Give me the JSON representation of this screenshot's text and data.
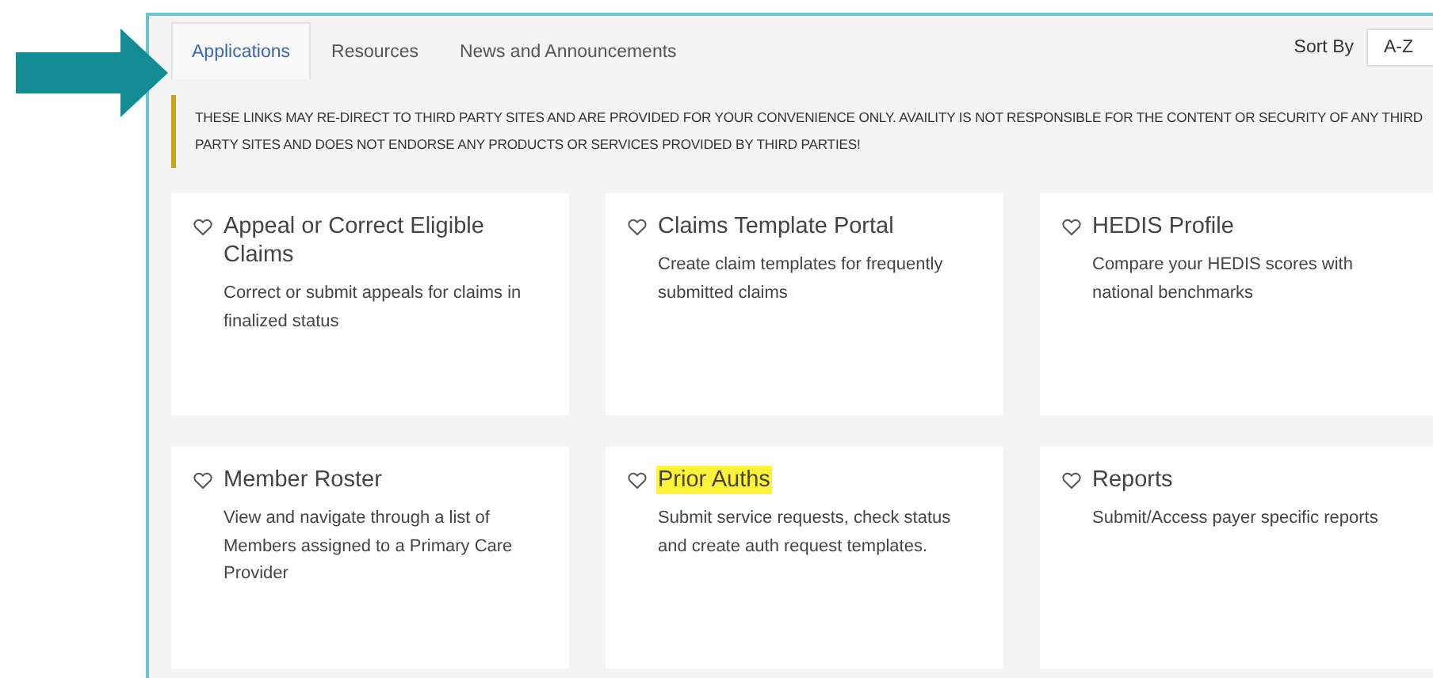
{
  "tabs": [
    {
      "label": "Applications",
      "selected": true
    },
    {
      "label": "Resources",
      "selected": false
    },
    {
      "label": "News and Announcements",
      "selected": false
    }
  ],
  "sort": {
    "label": "Sort By",
    "value": "A-Z"
  },
  "notice": "THESE LINKS MAY RE-DIRECT TO THIRD PARTY SITES AND ARE PROVIDED FOR YOUR CONVENIENCE ONLY. AVAILITY IS NOT RESPONSIBLE FOR THE CONTENT OR SECURITY OF ANY THIRD PARTY SITES AND DOES NOT ENDORSE ANY PRODUCTS OR SERVICES PROVIDED BY THIRD PARTIES!",
  "cards": [
    {
      "title": "Appeal or Correct Eligible Claims",
      "description": "Correct or submit appeals for claims in finalized status",
      "highlighted": false
    },
    {
      "title": "Claims Template Portal",
      "description": "Create claim templates for frequently submitted claims",
      "highlighted": false
    },
    {
      "title": "HEDIS Profile",
      "description": "Compare your HEDIS scores with national benchmarks",
      "highlighted": false
    },
    {
      "title": "Member Roster",
      "description": "View and navigate through a list of Members assigned to a Primary Care Provider",
      "highlighted": false
    },
    {
      "title": "Prior Auths",
      "description": "Submit service requests, check status and create auth request templates.",
      "highlighted": true
    },
    {
      "title": "Reports",
      "description": "Submit/Access payer specific reports",
      "highlighted": false
    }
  ]
}
